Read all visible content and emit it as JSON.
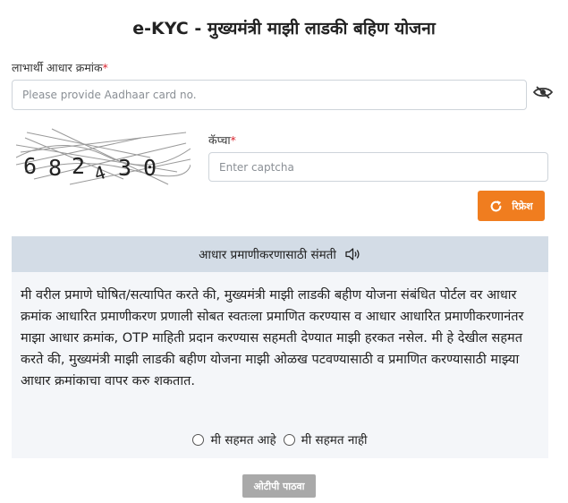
{
  "title": "e-KYC - मुख्यमंत्री माझी लाडकी बहिण योजना",
  "aadhaar": {
    "label": "लाभार्थी आधार क्रमांक",
    "required_mark": "*",
    "placeholder": "Please provide Aadhaar card no.",
    "value": ""
  },
  "captcha": {
    "image_text": "682430",
    "label": "कॅप्चा",
    "required_mark": "*",
    "placeholder": "Enter captcha",
    "value": "",
    "refresh_label": "रिफ्रेश"
  },
  "consent": {
    "heading": "आधार प्रमाणीकरणासाठी संमती",
    "text": "मी वरील प्रमाणे घोषित/सत्यापित करते की, मुख्यमंत्री माझी लाडकी बहीण योजना संबंधित पोर्टल वर आधार क्रमांक आधारित प्रमाणीकरण प्रणाली सोबत स्वतःला प्रमाणित करण्यास व आधार आधारित प्रमाणीकरणानंतर माझा आधार क्रमांक, OTP माहिती प्रदान करण्यास सहमती देण्यात माझी हरकत नसेल. मी हे देखील सहमत करते की, मुख्यमंत्री माझी लाडकी बहीण योजना माझी ओळख पटवण्यासाठी व प्रमाणित करण्यासाठी माझ्या आधार क्रमांकाचा वापर करु शकतात.",
    "options": [
      "मी सहमत आहे",
      "मी सहमत नाही"
    ],
    "selected": null
  },
  "submit_label": "ओटीपी पाठवा",
  "colors": {
    "accent": "#f07d1f",
    "required": "#d9232e",
    "consent_header_bg": "#d3dce6",
    "consent_body_bg": "#f4f6f9",
    "disabled_button": "#a9a9a9"
  }
}
